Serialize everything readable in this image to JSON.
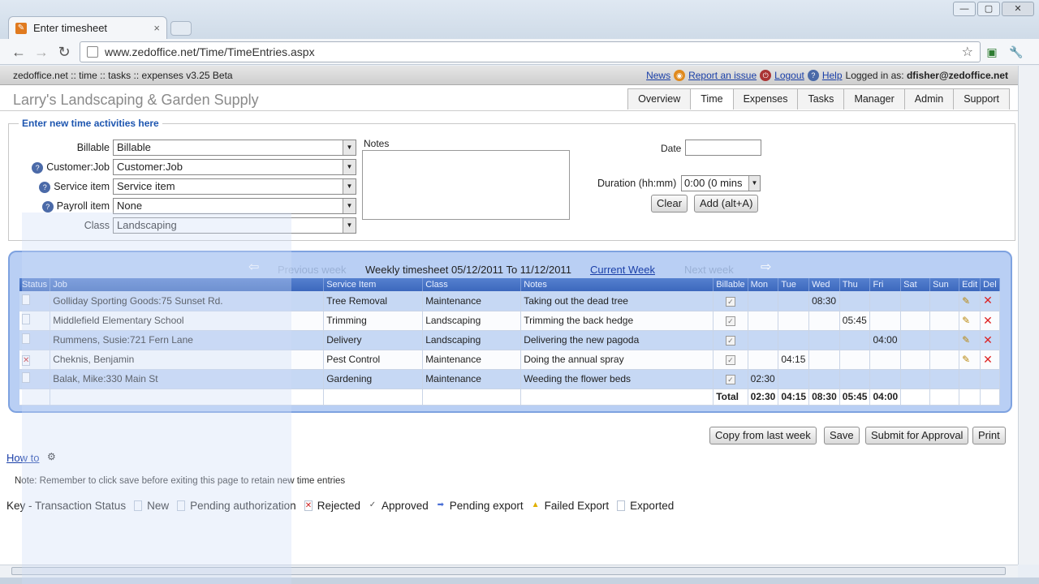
{
  "browser": {
    "tab_title": "Enter timesheet",
    "tab_close": "×",
    "url": "www.zedoffice.net/Time/TimeEntries.aspx",
    "window_buttons": [
      "—",
      "▢",
      "✕"
    ]
  },
  "app": {
    "version": "zedoffice.net :: time :: tasks :: expenses v3.25 Beta",
    "links": {
      "news": "News",
      "report": "Report an issue",
      "logout": "Logout",
      "help": "Help"
    },
    "logged_in_prefix": "Logged in as: ",
    "user": "dfisher@zedoffice.net",
    "company": "Larry's Landscaping & Garden Supply",
    "nav_tabs": [
      "Overview",
      "Time",
      "Expenses",
      "Tasks",
      "Manager",
      "Admin",
      "Support"
    ],
    "active_tab": "Time"
  },
  "entry": {
    "legend": "Enter new time activities here",
    "fields": {
      "billable": {
        "label": "Billable",
        "value": "Billable"
      },
      "customer_job": {
        "label": "Customer:Job",
        "value": "Customer:Job"
      },
      "service_item": {
        "label": "Service item",
        "value": "Service item"
      },
      "payroll_item": {
        "label": "Payroll item",
        "value": "None"
      },
      "class": {
        "label": "Class",
        "value": "Landscaping"
      }
    },
    "notes_label": "Notes",
    "date_label": "Date",
    "duration_label": "Duration (hh:mm)",
    "duration_value": "0:00 (0 mins",
    "clear_label": "Clear",
    "add_label": "Add (alt+A)"
  },
  "week": {
    "previous": "Previous week",
    "title": "Weekly timesheet 05/12/2011 To 11/12/2011",
    "current": "Current Week",
    "next": "Next week",
    "columns": [
      "Status",
      "Job",
      "Service Item",
      "Class",
      "Notes",
      "Billable",
      "Mon",
      "Tue",
      "Wed",
      "Thu",
      "Fri",
      "Sat",
      "Sun",
      "Edit",
      "Del"
    ],
    "rows": [
      {
        "status": "new",
        "job": "Golliday Sporting Goods:75 Sunset Rd.",
        "service": "Tree Removal",
        "class": "Maintenance",
        "notes": "Taking out the dead tree",
        "mon": "",
        "tue": "",
        "wed": "08:30",
        "thu": "",
        "fri": "",
        "sat": "",
        "sun": "",
        "editable": true
      },
      {
        "status": "new",
        "job": "Middlefield Elementary School",
        "service": "Trimming",
        "class": "Landscaping",
        "notes": "Trimming the back hedge",
        "mon": "",
        "tue": "",
        "wed": "",
        "thu": "05:45",
        "fri": "",
        "sat": "",
        "sun": "",
        "editable": true
      },
      {
        "status": "new",
        "job": "Rummens, Susie:721 Fern Lane",
        "service": "Delivery",
        "class": "Landscaping",
        "notes": "Delivering the new pagoda",
        "mon": "",
        "tue": "",
        "wed": "",
        "thu": "",
        "fri": "04:00",
        "sat": "",
        "sun": "",
        "editable": true
      },
      {
        "status": "rejected",
        "job": "Cheknis, Benjamin",
        "service": "Pest Control",
        "class": "Maintenance",
        "notes": "Doing the annual spray",
        "mon": "",
        "tue": "04:15",
        "wed": "",
        "thu": "",
        "fri": "",
        "sat": "",
        "sun": "",
        "editable": true
      },
      {
        "status": "exported",
        "job": "Balak, Mike:330 Main St",
        "service": "Gardening",
        "class": "Maintenance",
        "notes": "Weeding the flower beds",
        "mon": "02:30",
        "tue": "",
        "wed": "",
        "thu": "",
        "fri": "",
        "sat": "",
        "sun": "",
        "editable": false
      }
    ],
    "totals": {
      "label": "Total",
      "mon": "02:30",
      "tue": "04:15",
      "wed": "08:30",
      "thu": "05:45",
      "fri": "04:00",
      "sat": "",
      "sun": ""
    }
  },
  "actions": [
    "Copy from last week",
    "Save",
    "Submit for Approval",
    "Print"
  ],
  "howto": "How to",
  "note": "Note: Remember to click save before exiting this page to retain new time entries",
  "key": {
    "label": "Key - Transaction Status",
    "items": [
      "New",
      "Pending authorization",
      "Rejected",
      "Approved",
      "Pending export",
      "Failed Export",
      "Exported"
    ]
  }
}
